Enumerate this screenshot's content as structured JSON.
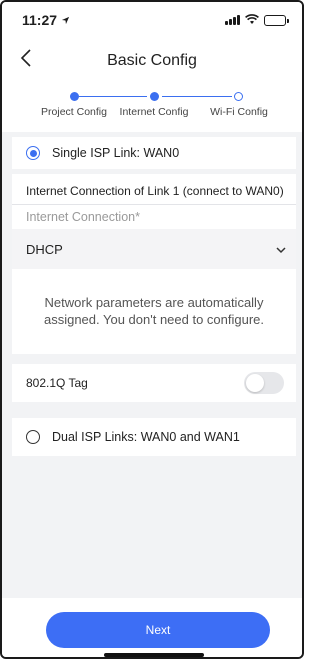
{
  "status_bar": {
    "time": "11:27"
  },
  "nav": {
    "title": "Basic Config"
  },
  "stepper": {
    "steps": [
      {
        "label": "Project Config",
        "state": "done"
      },
      {
        "label": "Internet Config",
        "state": "current"
      },
      {
        "label": "Wi-Fi Config",
        "state": "todo"
      }
    ]
  },
  "single_isp": {
    "label": "Single ISP Link: WAN0",
    "selected": true
  },
  "link1": {
    "section_title": "Internet Connection of Link 1 (connect to WAN0)",
    "field_label": "Internet Connection*",
    "selected_value": "DHCP",
    "info_text": "Network parameters are automatically assigned. You don't need to configure."
  },
  "vlan": {
    "label": "802.1Q Tag",
    "enabled": false
  },
  "dual_isp": {
    "label": "Dual ISP Links: WAN0 and WAN1",
    "selected": false
  },
  "footer": {
    "next_label": "Next"
  },
  "colors": {
    "accent": "#3d6ef5",
    "background": "#f2f3f5"
  }
}
